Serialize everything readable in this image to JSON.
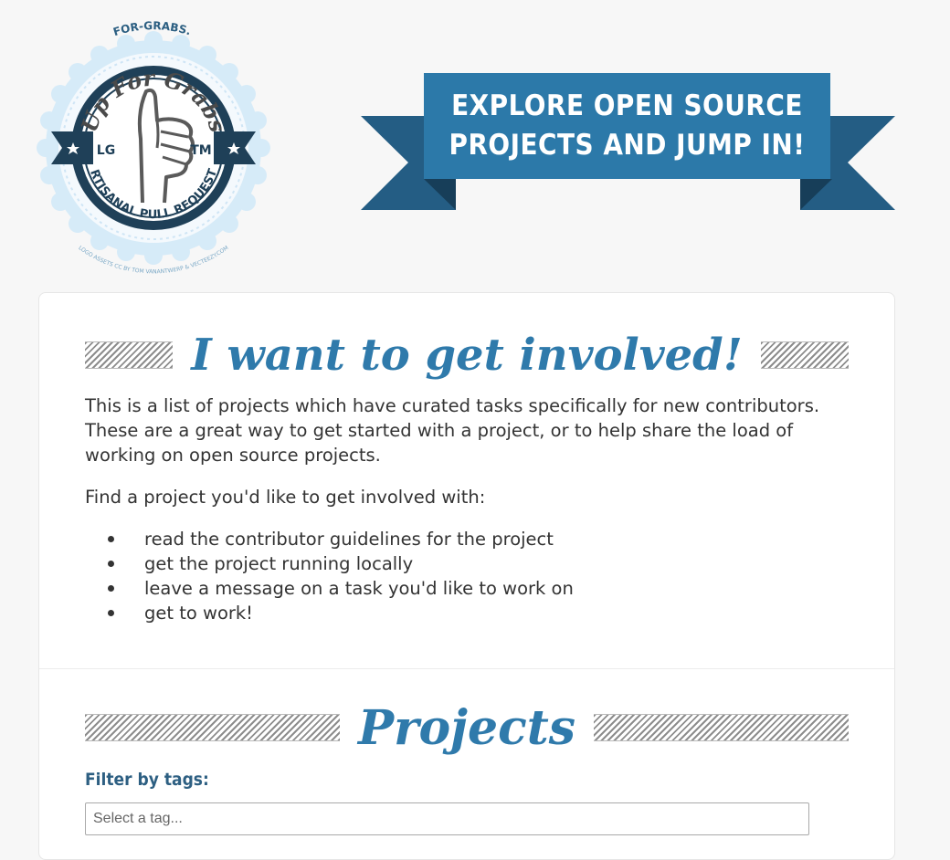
{
  "logo": {
    "site_name": "UP-FOR-GRABS.NET",
    "title": "Up For Grabs",
    "left_badge": "LG",
    "right_badge": "TM",
    "tagline": "ARTISANAL PULL REQUESTS",
    "credit": "LOGO ASSETS CC BY TOM VANANTWERP & VECTEEZY.COM"
  },
  "banner": {
    "line1": "EXPLORE OPEN SOURCE",
    "line2": "PROJECTS AND JUMP IN!"
  },
  "intro": {
    "heading": "I want to get involved!",
    "paragraph1": "This is a list of projects which have curated tasks specifically for new contributors. These are a great way to get started with a project, or to help share the load of working on open source projects.",
    "paragraph2": "Find a project you'd like to get involved with:",
    "steps": [
      "read the contributor guidelines for the project",
      "get the project running locally",
      "leave a message on a task you'd like to work on",
      "get to work!"
    ]
  },
  "projects": {
    "heading": "Projects",
    "filter_label": "Filter by tags:",
    "tag_placeholder": "Select a tag..."
  },
  "colors": {
    "brand_blue": "#2f7aab",
    "banner_blue": "#2c79a9",
    "banner_dark": "#245d84",
    "label_blue": "#2d5f82"
  }
}
